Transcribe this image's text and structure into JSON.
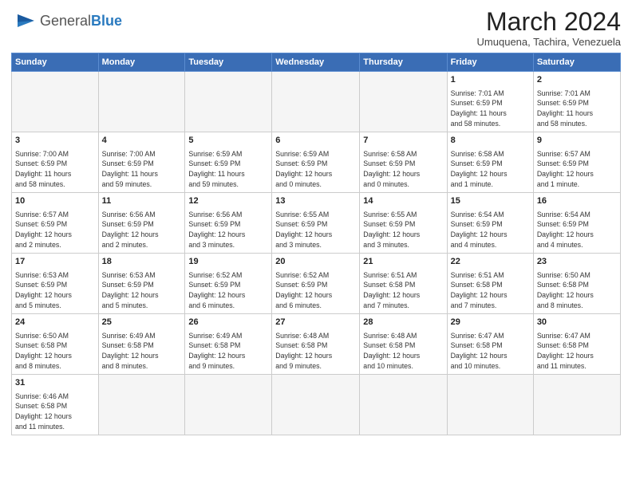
{
  "logo": {
    "text_general": "General",
    "text_blue": "Blue"
  },
  "title": "March 2024",
  "location": "Umuquena, Tachira, Venezuela",
  "days_of_week": [
    "Sunday",
    "Monday",
    "Tuesday",
    "Wednesday",
    "Thursday",
    "Friday",
    "Saturday"
  ],
  "weeks": [
    [
      {
        "day": "",
        "info": ""
      },
      {
        "day": "",
        "info": ""
      },
      {
        "day": "",
        "info": ""
      },
      {
        "day": "",
        "info": ""
      },
      {
        "day": "",
        "info": ""
      },
      {
        "day": "1",
        "info": "Sunrise: 7:01 AM\nSunset: 6:59 PM\nDaylight: 11 hours\nand 58 minutes."
      },
      {
        "day": "2",
        "info": "Sunrise: 7:01 AM\nSunset: 6:59 PM\nDaylight: 11 hours\nand 58 minutes."
      }
    ],
    [
      {
        "day": "3",
        "info": "Sunrise: 7:00 AM\nSunset: 6:59 PM\nDaylight: 11 hours\nand 58 minutes."
      },
      {
        "day": "4",
        "info": "Sunrise: 7:00 AM\nSunset: 6:59 PM\nDaylight: 11 hours\nand 59 minutes."
      },
      {
        "day": "5",
        "info": "Sunrise: 6:59 AM\nSunset: 6:59 PM\nDaylight: 11 hours\nand 59 minutes."
      },
      {
        "day": "6",
        "info": "Sunrise: 6:59 AM\nSunset: 6:59 PM\nDaylight: 12 hours\nand 0 minutes."
      },
      {
        "day": "7",
        "info": "Sunrise: 6:58 AM\nSunset: 6:59 PM\nDaylight: 12 hours\nand 0 minutes."
      },
      {
        "day": "8",
        "info": "Sunrise: 6:58 AM\nSunset: 6:59 PM\nDaylight: 12 hours\nand 1 minute."
      },
      {
        "day": "9",
        "info": "Sunrise: 6:57 AM\nSunset: 6:59 PM\nDaylight: 12 hours\nand 1 minute."
      }
    ],
    [
      {
        "day": "10",
        "info": "Sunrise: 6:57 AM\nSunset: 6:59 PM\nDaylight: 12 hours\nand 2 minutes."
      },
      {
        "day": "11",
        "info": "Sunrise: 6:56 AM\nSunset: 6:59 PM\nDaylight: 12 hours\nand 2 minutes."
      },
      {
        "day": "12",
        "info": "Sunrise: 6:56 AM\nSunset: 6:59 PM\nDaylight: 12 hours\nand 3 minutes."
      },
      {
        "day": "13",
        "info": "Sunrise: 6:55 AM\nSunset: 6:59 PM\nDaylight: 12 hours\nand 3 minutes."
      },
      {
        "day": "14",
        "info": "Sunrise: 6:55 AM\nSunset: 6:59 PM\nDaylight: 12 hours\nand 3 minutes."
      },
      {
        "day": "15",
        "info": "Sunrise: 6:54 AM\nSunset: 6:59 PM\nDaylight: 12 hours\nand 4 minutes."
      },
      {
        "day": "16",
        "info": "Sunrise: 6:54 AM\nSunset: 6:59 PM\nDaylight: 12 hours\nand 4 minutes."
      }
    ],
    [
      {
        "day": "17",
        "info": "Sunrise: 6:53 AM\nSunset: 6:59 PM\nDaylight: 12 hours\nand 5 minutes."
      },
      {
        "day": "18",
        "info": "Sunrise: 6:53 AM\nSunset: 6:59 PM\nDaylight: 12 hours\nand 5 minutes."
      },
      {
        "day": "19",
        "info": "Sunrise: 6:52 AM\nSunset: 6:59 PM\nDaylight: 12 hours\nand 6 minutes."
      },
      {
        "day": "20",
        "info": "Sunrise: 6:52 AM\nSunset: 6:59 PM\nDaylight: 12 hours\nand 6 minutes."
      },
      {
        "day": "21",
        "info": "Sunrise: 6:51 AM\nSunset: 6:58 PM\nDaylight: 12 hours\nand 7 minutes."
      },
      {
        "day": "22",
        "info": "Sunrise: 6:51 AM\nSunset: 6:58 PM\nDaylight: 12 hours\nand 7 minutes."
      },
      {
        "day": "23",
        "info": "Sunrise: 6:50 AM\nSunset: 6:58 PM\nDaylight: 12 hours\nand 8 minutes."
      }
    ],
    [
      {
        "day": "24",
        "info": "Sunrise: 6:50 AM\nSunset: 6:58 PM\nDaylight: 12 hours\nand 8 minutes."
      },
      {
        "day": "25",
        "info": "Sunrise: 6:49 AM\nSunset: 6:58 PM\nDaylight: 12 hours\nand 8 minutes."
      },
      {
        "day": "26",
        "info": "Sunrise: 6:49 AM\nSunset: 6:58 PM\nDaylight: 12 hours\nand 9 minutes."
      },
      {
        "day": "27",
        "info": "Sunrise: 6:48 AM\nSunset: 6:58 PM\nDaylight: 12 hours\nand 9 minutes."
      },
      {
        "day": "28",
        "info": "Sunrise: 6:48 AM\nSunset: 6:58 PM\nDaylight: 12 hours\nand 10 minutes."
      },
      {
        "day": "29",
        "info": "Sunrise: 6:47 AM\nSunset: 6:58 PM\nDaylight: 12 hours\nand 10 minutes."
      },
      {
        "day": "30",
        "info": "Sunrise: 6:47 AM\nSunset: 6:58 PM\nDaylight: 12 hours\nand 11 minutes."
      }
    ],
    [
      {
        "day": "31",
        "info": "Sunrise: 6:46 AM\nSunset: 6:58 PM\nDaylight: 12 hours\nand 11 minutes."
      },
      {
        "day": "",
        "info": ""
      },
      {
        "day": "",
        "info": ""
      },
      {
        "day": "",
        "info": ""
      },
      {
        "day": "",
        "info": ""
      },
      {
        "day": "",
        "info": ""
      },
      {
        "day": "",
        "info": ""
      }
    ]
  ]
}
